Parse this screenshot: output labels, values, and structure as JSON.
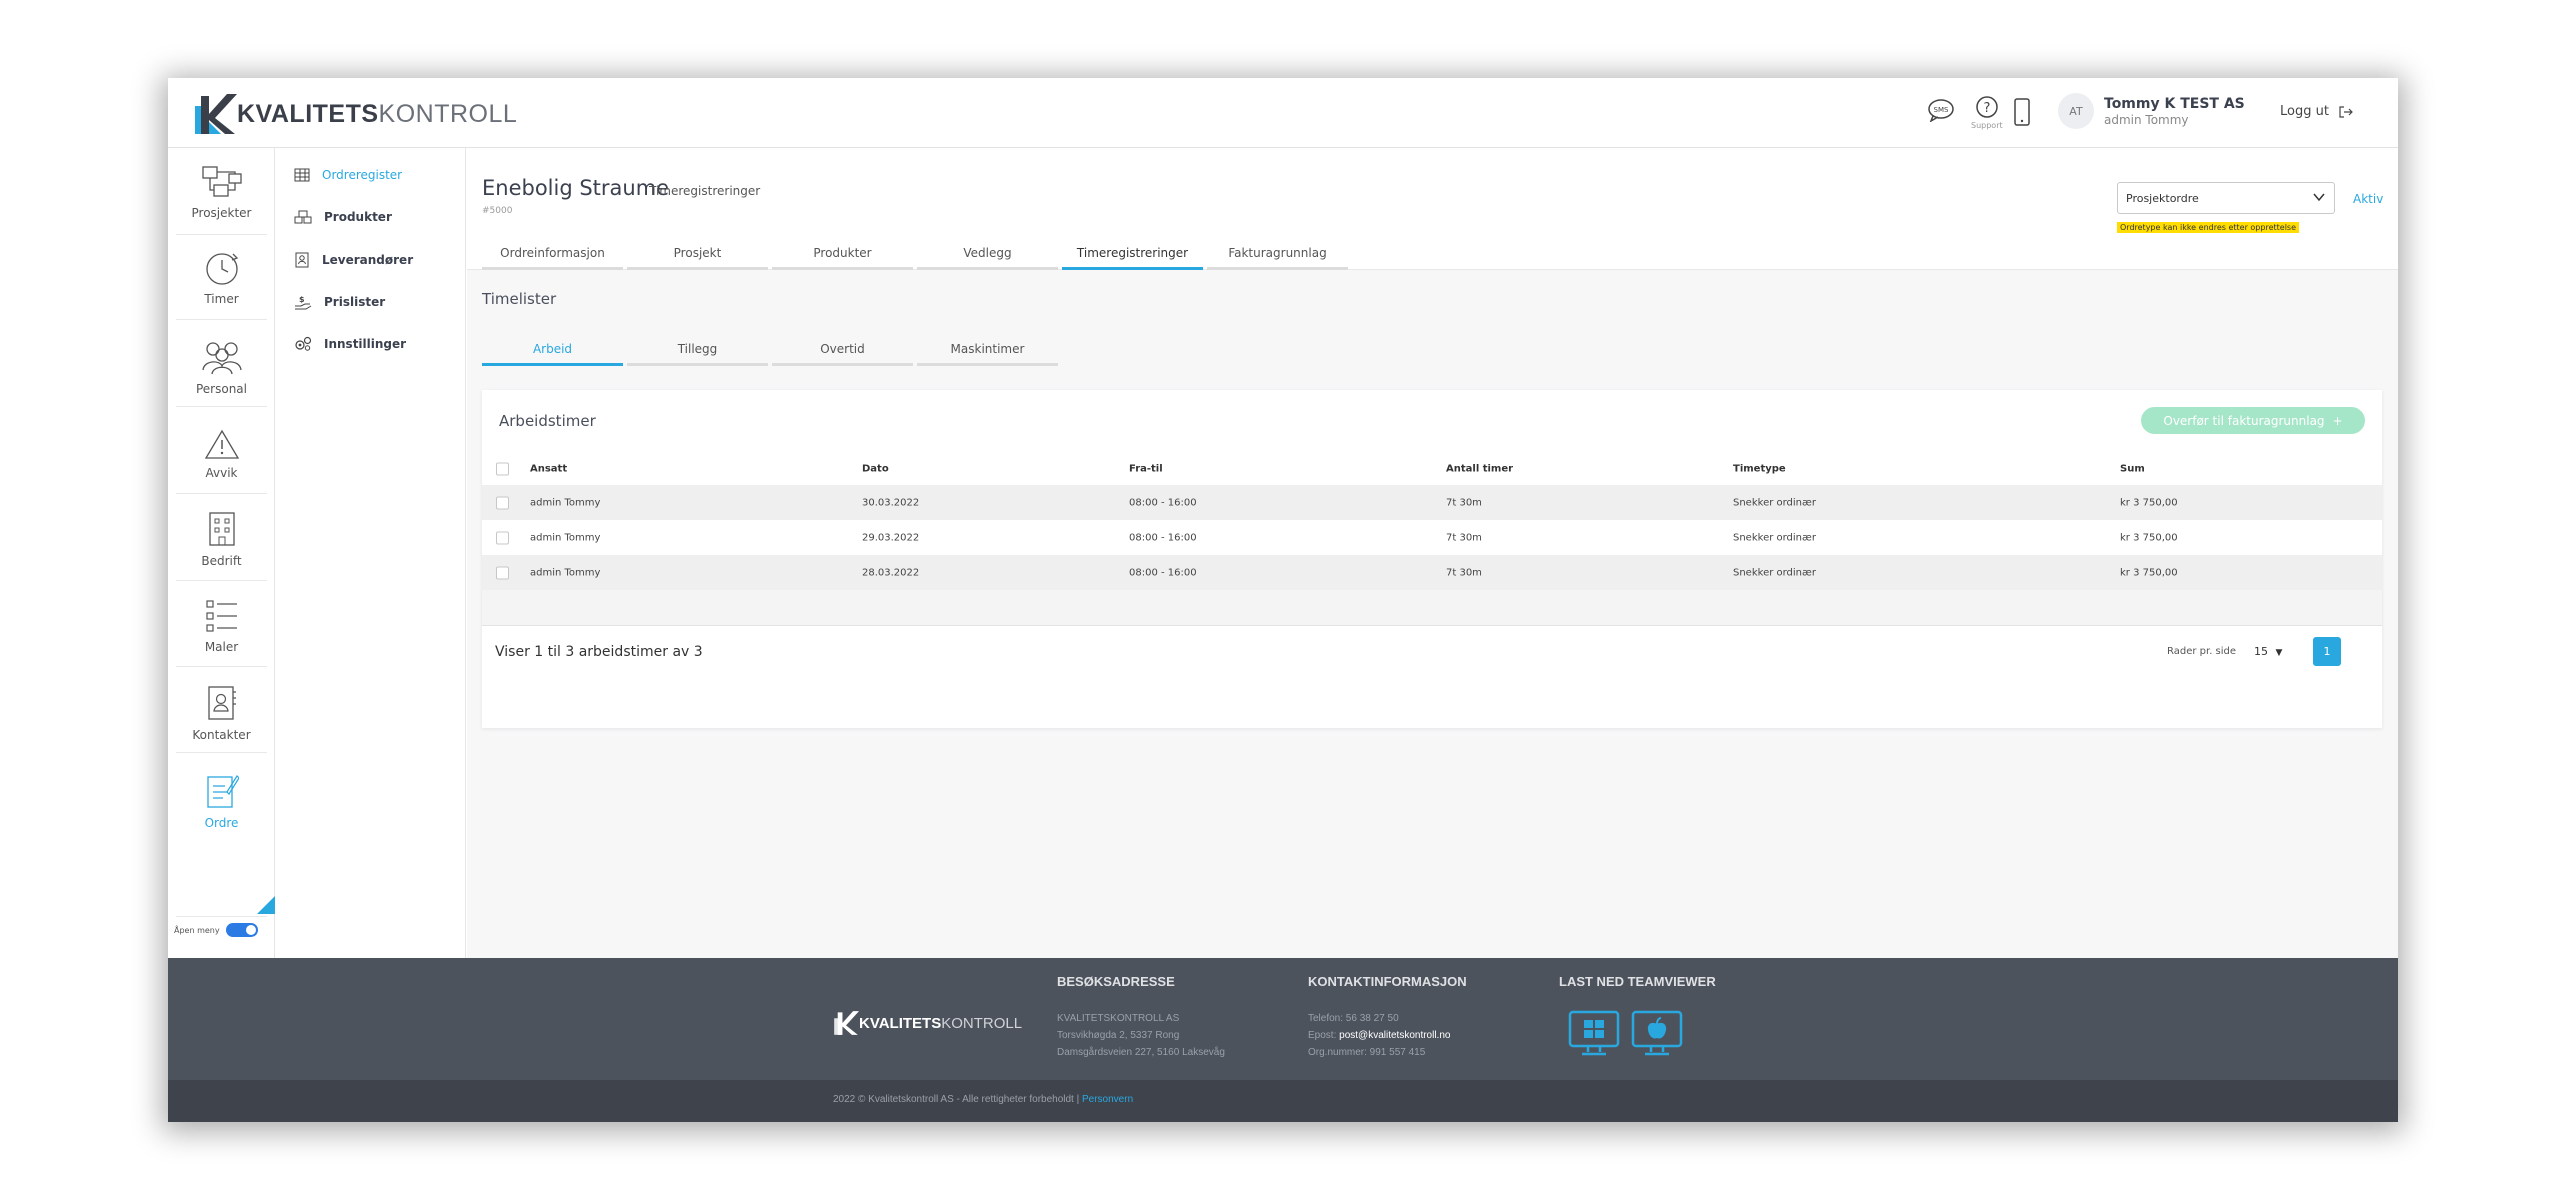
{
  "header": {
    "logo_bold": "KVALITETS",
    "logo_light": "KONTROLL",
    "support_label": "Support",
    "sms_label": "SMS",
    "avatar_initials": "AT",
    "company": "Tommy K TEST AS",
    "user": "admin Tommy",
    "logout": "Logg ut"
  },
  "rail": {
    "items": [
      {
        "label": "Prosjekter"
      },
      {
        "label": "Timer"
      },
      {
        "label": "Personal"
      },
      {
        "label": "Avvik"
      },
      {
        "label": "Bedrift"
      },
      {
        "label": "Maler"
      },
      {
        "label": "Kontakter"
      },
      {
        "label": "Ordre"
      }
    ],
    "toggle_label": "Åpen meny"
  },
  "submenu": {
    "items": [
      {
        "label": "Ordreregister"
      },
      {
        "label": "Produkter"
      },
      {
        "label": "Leverandører"
      },
      {
        "label": "Prislister"
      },
      {
        "label": "Innstillinger"
      }
    ]
  },
  "page": {
    "title": "Enebolig Straume",
    "subtitle": "Timeregistreringer",
    "number": "#5000",
    "ordertype": "Prosjektordre",
    "ordertype_warning": "Ordretype kan ikke endres etter opprettelse",
    "status": "Aktiv",
    "tabs": [
      "Ordreinformasjon",
      "Prosjekt",
      "Produkter",
      "Vedlegg",
      "Timeregistreringer",
      "Fakturagrunnlag"
    ],
    "section_label": "Timelister",
    "subtabs": [
      "Arbeid",
      "Tillegg",
      "Overtid",
      "Maskintimer"
    ]
  },
  "card": {
    "title": "Arbeidstimer",
    "transfer_label": "Overfør til fakturagrunnlag",
    "transfer_plus": "+",
    "columns": [
      "Ansatt",
      "Dato",
      "Fra-til",
      "Antall timer",
      "Timetype",
      "Sum"
    ],
    "rows": [
      [
        "admin Tommy",
        "30.03.2022",
        "08:00 - 16:00",
        "7t 30m",
        "Snekker ordinær",
        "kr 3 750,00"
      ],
      [
        "admin Tommy",
        "29.03.2022",
        "08:00 - 16:00",
        "7t 30m",
        "Snekker ordinær",
        "kr 3 750,00"
      ],
      [
        "admin Tommy",
        "28.03.2022",
        "08:00 - 16:00",
        "7t 30m",
        "Snekker ordinær",
        "kr 3 750,00"
      ]
    ],
    "showing": "Viser 1 til 3 arbeidstimer av 3",
    "rows_per_page_label": "Rader pr. side",
    "rows_per_page": "15",
    "page": "1"
  },
  "footer": {
    "logo_bold": "KVALITETS",
    "logo_light": "KONTROLL",
    "visit_heading": "BESØKSADRESSE",
    "visit_lines": [
      "KVALITETSKONTROLL AS",
      "Torsvikhøgda 2, 5337 Rong",
      "Damsgårdsveien 227, 5160 Laksevåg"
    ],
    "contact_heading": "KONTAKTINFORMASJON",
    "phone": "Telefon: 56 38 27 50",
    "email_prefix": "Epost: ",
    "email": "post@kvalitetskontroll.no",
    "org": "Org.nummer: 991 557 415",
    "teamviewer_heading": "LAST NED TEAMVIEWER",
    "copyright": "2022 © Kvalitetskontroll AS - Alle rettigheter forbeholdt |",
    "privacy": "Personvern"
  },
  "colors": {
    "accent": "#29a8e0",
    "footer": "#4d535d",
    "transfer_button": "#a6e6c8",
    "warning": "#ffdd00"
  }
}
